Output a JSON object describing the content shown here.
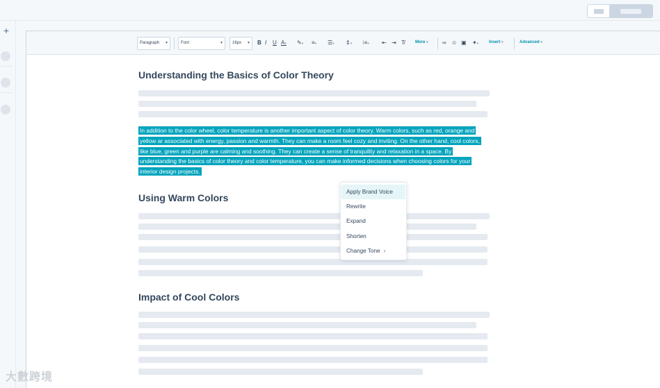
{
  "toolbar": {
    "paragraph": "Paragraph",
    "font": "Font",
    "size": "16px",
    "bold": "B",
    "italic": "I",
    "underline": "U",
    "text_color": "A",
    "more": "More",
    "insert": "Insert",
    "advanced": "Advanced"
  },
  "content": {
    "heading1": "Understanding the Basics of Color Theory",
    "selected_paragraph": "In addition to the color wheel, color temperature is another important aspect of color theory. Warm colors, such as red, orange and yellow ar associated with energy, passion and warmth. They can make a room feel cozy and inviting. On the other hand, cool colors, like blue, green and purple are calming and soothing. They can create a sense of tranquility and relaxation in a space. By understanding the basics of color theory and color temperature, you can make informed decisions when choosing colors for your interior design projects.",
    "heading2": "Using Warm Colors",
    "heading3": "Impact of Cool Colors"
  },
  "context_menu": {
    "items": [
      {
        "label": "Apply Brand Voice"
      },
      {
        "label": "Rewrite"
      },
      {
        "label": "Expand"
      },
      {
        "label": "Shorten"
      },
      {
        "label": "Change Tone"
      }
    ]
  },
  "watermark": "大數跨境",
  "colors": {
    "selection": "#00a4bd",
    "accent": "#0091ae",
    "text": "#33475b",
    "skeleton": "#e5eaf0"
  }
}
